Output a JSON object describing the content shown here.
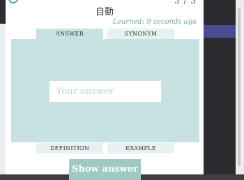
{
  "header": {
    "counter": "3 / 3",
    "prompt": "自動",
    "learned_status": "Learned: 9 seconds ago"
  },
  "tabs_top": [
    {
      "label": "ANSWER",
      "active": true
    },
    {
      "label": "SYNONYM",
      "active": false
    }
  ],
  "tabs_bottom": [
    {
      "label": "DEFINITION"
    },
    {
      "label": "EXAMPLE"
    }
  ],
  "answer": {
    "placeholder": "Your answer",
    "value": ""
  },
  "show_answer_button": "Show answer",
  "colors": {
    "accent": "#9fcac3",
    "tab_active": "#c8e1e1",
    "tab_inactive": "#e7f1f1",
    "learned_text": "#74a89a"
  },
  "icons": {
    "help": "help-circle-icon"
  }
}
